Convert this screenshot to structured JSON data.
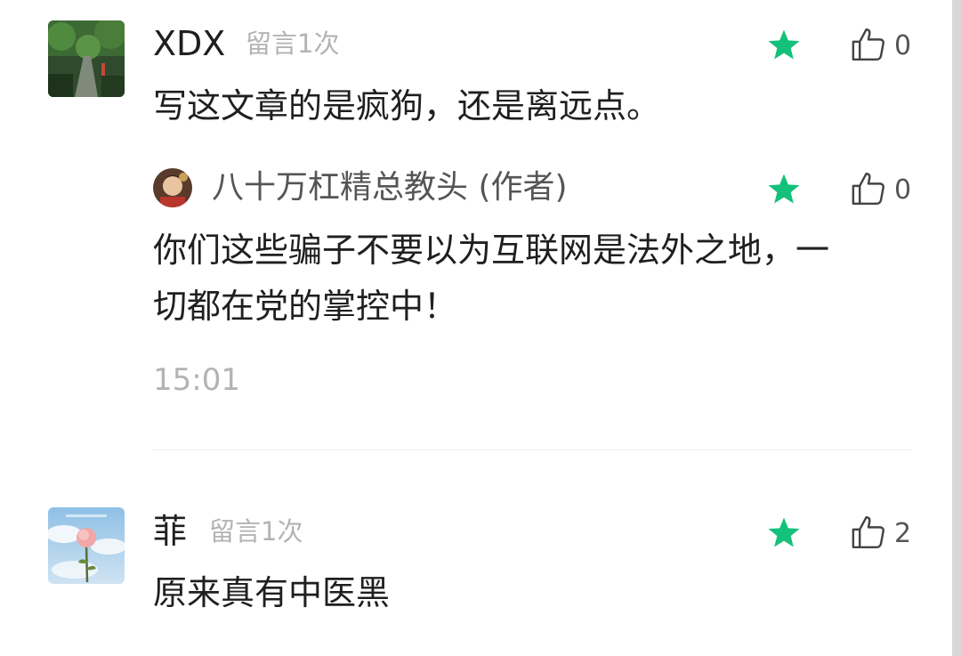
{
  "comments": [
    {
      "author": "XDX",
      "message_count": "留言1次",
      "text": "写这文章的是疯狗，还是离远点。",
      "like_count": "0",
      "reply": {
        "author": "八十万杠精总教头 (作者)",
        "text_line1": "你们这些骗子不要以为互联网是法外之地，一",
        "text_line2": "切都在党的掌控中！",
        "like_count": "0"
      },
      "time": "15:01"
    },
    {
      "author": "菲",
      "message_count": "留言1次",
      "text": "原来真有中医黑",
      "like_count": "2"
    }
  ],
  "colors": {
    "star": "#14c17a",
    "name": "#1f1f1f",
    "muted": "#b3b3b3",
    "reply_name": "#555555"
  },
  "icons": {
    "star": "star-icon",
    "like": "thumbs-up-icon"
  }
}
